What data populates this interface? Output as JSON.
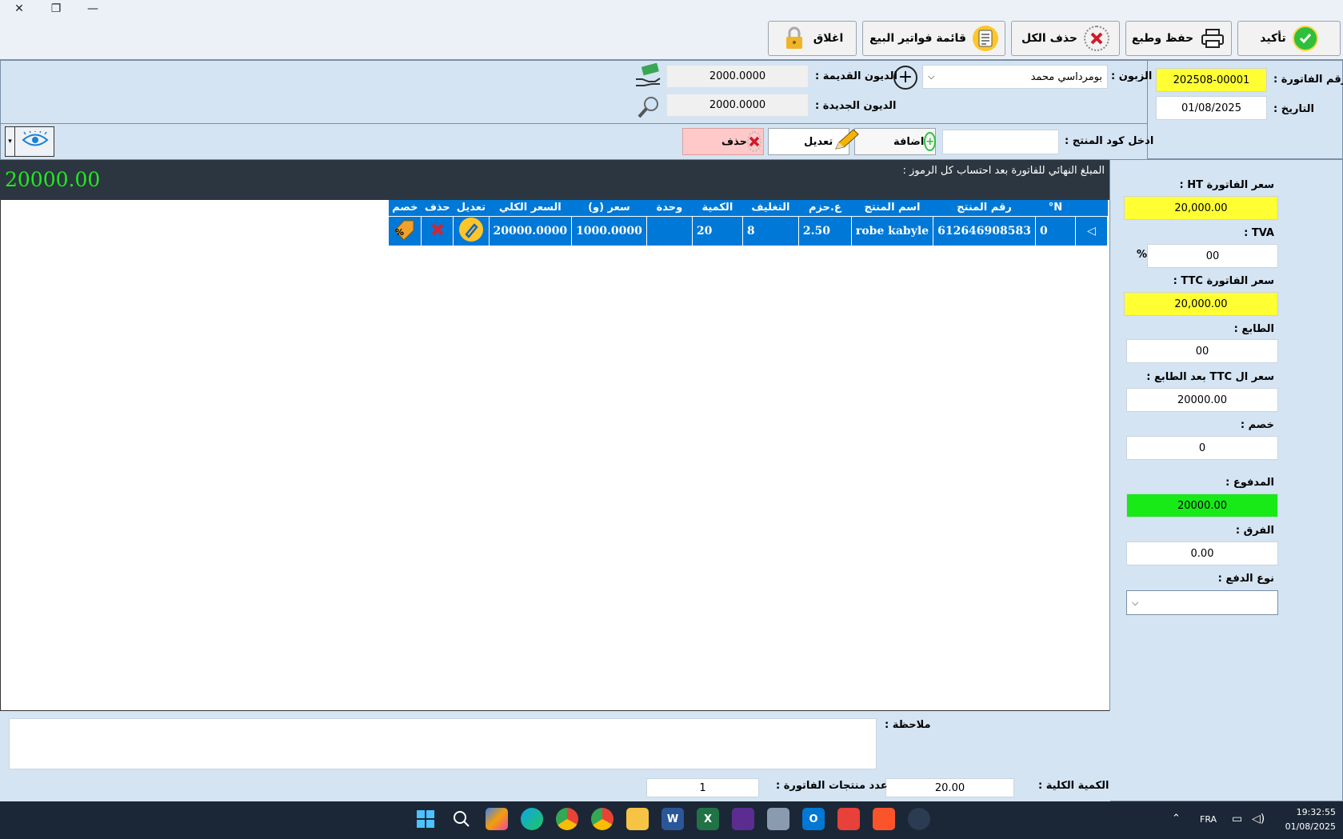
{
  "toolbar": {
    "confirm": "تأكيد",
    "save_print": "حفظ وطبع",
    "delete_all": "حذف الكل",
    "sales_invoices": "قائمة فواتير البيع",
    "close": "اغلاق"
  },
  "header": {
    "invoice_no_label": "رقم الفاتورة :",
    "invoice_no": "202508-00001",
    "date_label": "التاريخ :",
    "date": "01/08/2025",
    "customer_label": "الزبون :",
    "customer": "بومرداسي محمد",
    "old_debts_label": "الديون القديمة :",
    "old_debts": "2000.0000",
    "new_debts_label": "الديون الجديدة :",
    "new_debts": "2000.0000",
    "product_code_label": "ادخل كود المنتج :",
    "product_code": "",
    "add": "اضافة",
    "edit": "تعديل",
    "delete": "حذف"
  },
  "total_bar": {
    "label": "المبلغ النهائي للفاتورة بعد احتساب كل الرموز :",
    "amount": "20000.00"
  },
  "table": {
    "columns": [
      "N°",
      "رقم المنتج",
      "اسم المنتج",
      "ع.حزم",
      "التغليف",
      "الكمية",
      "وحدة",
      "سعر (و)",
      "السعر الكلي",
      "تعديل",
      "حذف",
      "خصم"
    ],
    "rows": [
      {
        "n": "0",
        "code": "612646908583",
        "name": "robe kabyle",
        "packs": "2.50",
        "packaging": "8",
        "qty": "20",
        "unit": "",
        "unit_price": "1000.0000",
        "total": "20000.0000"
      }
    ]
  },
  "sidebar": {
    "ht_label": "سعر الفاتورة HT :",
    "ht": "20,000.00",
    "tva_label": "TVA :",
    "tva": "00",
    "tva_unit": "%",
    "ttc_label": "سعر الفاتورة TTC :",
    "ttc": "20,000.00",
    "stamp_label": "الطابع :",
    "stamp": "00",
    "ttc_after_label": "سعر ال TTC بعد الطابع :",
    "ttc_after": "20000.00",
    "discount_label": "خصم :",
    "discount": "0",
    "paid_label": "المدفوع :",
    "paid": "20000.00",
    "diff_label": "الفرق :",
    "diff": "0.00",
    "payment_type_label": "نوع الدفع :",
    "payment_type": ""
  },
  "footer": {
    "note_label": "ملاحظة :",
    "note": "",
    "total_qty_label": "الكمية الكلية :",
    "total_qty": "20.00",
    "items_count_label": "عدد منتجات الفاتورة :",
    "items_count": "1"
  },
  "taskbar": {
    "lang": "FRA",
    "time": "19:32:55",
    "date": "01/08/2025"
  },
  "colors": {
    "accent": "#0078d7",
    "yellow": "#ffff33",
    "green_field": "#17ea17",
    "total_green": "#22e822",
    "dark_bar": "#2c3640",
    "panel_bg": "#d4e4f3"
  }
}
